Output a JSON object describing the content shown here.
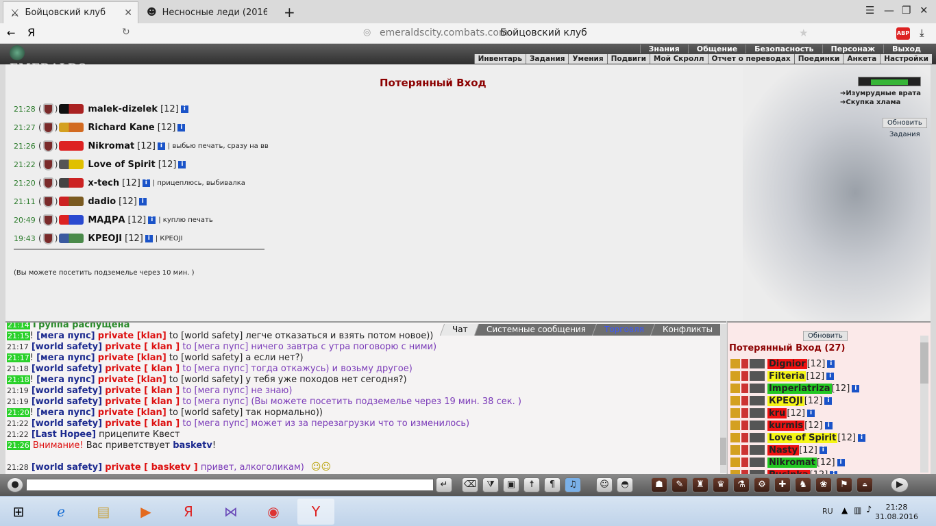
{
  "browser": {
    "tabs": [
      {
        "title": "Бойцовский клуб",
        "active": true
      },
      {
        "title": "Несносные леди (2016)",
        "active": false
      }
    ],
    "url": "emeraldscity.combats.com",
    "page_title": "Бойцовский клуб",
    "adblock": "ABP"
  },
  "game": {
    "logo": "EMERALDS",
    "menu_top": [
      "Знания",
      "Общение",
      "Безопасность",
      "Персонаж",
      "Выход"
    ],
    "menu_sub": [
      "Инвентарь",
      "Задания",
      "Умения",
      "Подвиги",
      "Мой Скролл",
      "Отчет о переводах",
      "Поединки",
      "Анкета",
      "Настройки"
    ],
    "title": "Потерянный Вход",
    "energy_fraction": 0.75,
    "right_links": [
      "Изумрудные врата",
      "Скупка хлама"
    ],
    "refresh_button": "Обновить",
    "tasks_button": "Задания",
    "dungeon_note": "(Вы можете посетить подземелье через 10 мин. )",
    "users": [
      {
        "time": "21:28",
        "open": "(",
        "close": ")",
        "nick": "malek-dizelek",
        "level": "[12]",
        "note": ""
      },
      {
        "time": "21:27",
        "open": "(",
        "close": ")",
        "nick": "Richard Kane",
        "level": "[12]",
        "note": ""
      },
      {
        "time": "21:26",
        "open": "(",
        "close": ")",
        "nick": "Nikromat",
        "level": "[12]",
        "note": "| выбью печать, сразу на вв"
      },
      {
        "time": "21:22",
        "open": "(",
        "close": ")",
        "nick": "Love of Spirit",
        "level": "[12]",
        "note": ""
      },
      {
        "time": "21:20",
        "open": "(",
        "close": ")",
        "nick": "x-tech",
        "level": "[12]",
        "note": "| прицеплюсь, выбивалка"
      },
      {
        "time": "21:11",
        "open": "(",
        "close": ")",
        "nick": "dadio",
        "level": "[12]",
        "note": ""
      },
      {
        "time": "20:49",
        "open": "(",
        "close": ")",
        "nick": "МАДРА",
        "level": "[12]",
        "note": "| куплю печать"
      },
      {
        "time": "19:43",
        "open": "(",
        "close": ")",
        "nick": "КРЕОЈІ",
        "level": "[12]",
        "note": "| КРЕОЈІ"
      }
    ],
    "info_glyph": "i"
  },
  "chat": {
    "tabs": [
      {
        "label": "Чат",
        "active": true
      },
      {
        "label": "Системные сообщения"
      },
      {
        "label": "Торговля",
        "blue": true
      },
      {
        "label": "Конфликты"
      }
    ],
    "first_line": "Группа распущена",
    "lines": [
      {
        "time": "21:15",
        "hl": true,
        "bang": "!",
        "from": "[мега пупс]",
        "priv": "private [klan]",
        "to": "to [world safety]",
        "msg": "легче отказаться и взять потом новое))",
        "style": "dark"
      },
      {
        "time": "21:17",
        "hl": false,
        "bang": "",
        "from": "[world safety]",
        "priv": "private [ klan ]",
        "to": "to [мега пупс]",
        "msg": "ничего завтра с утра поговорю с ними)",
        "style": "purple"
      },
      {
        "time": "21:17",
        "hl": true,
        "bang": "!",
        "from": "[мега пупс]",
        "priv": "private [klan]",
        "to": "to [world safety]",
        "msg": "а если нет?)",
        "style": "dark"
      },
      {
        "time": "21:18",
        "hl": false,
        "bang": "",
        "from": "[world safety]",
        "priv": "private [ klan ]",
        "to": "to [мега пупс]",
        "msg": "тогда откажусь) и возьму другое)",
        "style": "purple"
      },
      {
        "time": "21:18",
        "hl": true,
        "bang": "!",
        "from": "[мега пупс]",
        "priv": "private [klan]",
        "to": "to [world safety]",
        "msg": "у тебя уже походов нет сегодня?)",
        "style": "dark"
      },
      {
        "time": "21:19",
        "hl": false,
        "bang": "",
        "from": "[world safety]",
        "priv": "private [ klan ]",
        "to": "to [мега пупс]",
        "msg": "не знаю)",
        "style": "purple"
      },
      {
        "time": "21:19",
        "hl": false,
        "bang": "",
        "from": "[world safety]",
        "priv": "private [ klan ]",
        "to": "to [мега пупс]",
        "msg": "(Вы можете посетить подземелье через 19 мин. 38 сек. )",
        "style": "purple"
      },
      {
        "time": "21:20",
        "hl": true,
        "bang": "!",
        "from": "[мега пупс]",
        "priv": "private [klan]",
        "to": "to [world safety]",
        "msg": "так нормально))",
        "style": "dark"
      },
      {
        "time": "21:22",
        "hl": false,
        "bang": "",
        "from": "[world safety]",
        "priv": "private [ klan ]",
        "to": "to [мега пупс]",
        "msg": "может из за перезагрузки что то изменилось)",
        "style": "purple"
      }
    ],
    "plain_line": {
      "time": "21:22",
      "from": "[Last Hopee]",
      "msg": "прицепите Квест"
    },
    "warn_line": {
      "time": "21:26",
      "warn": "Внимание!",
      "msg": "Вас приветствует",
      "nick": "basketv",
      "end": "!"
    },
    "last_line": {
      "time": "21:28",
      "from": "[world safety]",
      "priv": "private [ basketv ]",
      "msg": "привет, алкоголикам)"
    }
  },
  "userlist": {
    "refresh": "Обновить",
    "title": "Потерянный Вход (27)",
    "users": [
      {
        "nick": "Dignior",
        "level": "[12]",
        "color": "red"
      },
      {
        "nick": "Filteria",
        "level": "[12]",
        "color": "yel"
      },
      {
        "nick": "Imperiatriza",
        "level": "[12]",
        "color": "grn"
      },
      {
        "nick": "КРЕОЈІ",
        "level": "[12]",
        "color": "yel"
      },
      {
        "nick": "kru",
        "level": "[12]",
        "color": "red"
      },
      {
        "nick": "kurmis",
        "level": "[12]",
        "color": "red"
      },
      {
        "nick": "Love of Spirit",
        "level": "[12]",
        "color": "yel"
      },
      {
        "nick": "Nasty",
        "level": "[12]",
        "color": "red"
      },
      {
        "nick": "Nikromat",
        "level": "[12]",
        "color": "grn"
      },
      {
        "nick": "Pucinka",
        "level": "[12]",
        "color": "red"
      }
    ]
  },
  "taskbar": {
    "lang": "RU",
    "time": "21:28",
    "date": "31.08.2016"
  },
  "colors": {
    "title_red": "#8b0000",
    "time_green": "#2ad12a",
    "nick_blue": "#1c2a8f",
    "private_red": "#dd1111",
    "msg_purple": "#7a3ab8"
  }
}
